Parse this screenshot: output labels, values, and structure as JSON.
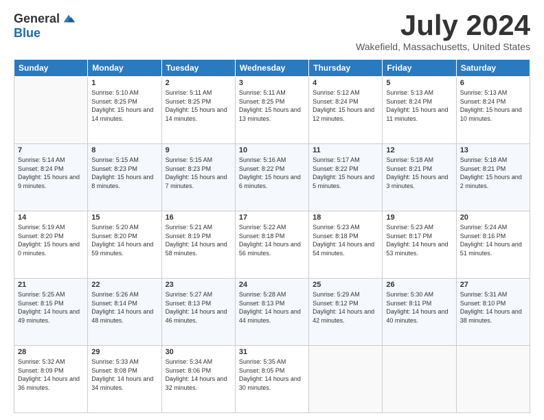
{
  "header": {
    "logo": {
      "general": "General",
      "blue": "Blue"
    },
    "title": "July 2024",
    "location": "Wakefield, Massachusetts, United States"
  },
  "days_of_week": [
    "Sunday",
    "Monday",
    "Tuesday",
    "Wednesday",
    "Thursday",
    "Friday",
    "Saturday"
  ],
  "weeks": [
    [
      {
        "day": "",
        "sunrise": "",
        "sunset": "",
        "daylight": ""
      },
      {
        "day": "1",
        "sunrise": "Sunrise: 5:10 AM",
        "sunset": "Sunset: 8:25 PM",
        "daylight": "Daylight: 15 hours and 14 minutes."
      },
      {
        "day": "2",
        "sunrise": "Sunrise: 5:11 AM",
        "sunset": "Sunset: 8:25 PM",
        "daylight": "Daylight: 15 hours and 14 minutes."
      },
      {
        "day": "3",
        "sunrise": "Sunrise: 5:11 AM",
        "sunset": "Sunset: 8:25 PM",
        "daylight": "Daylight: 15 hours and 13 minutes."
      },
      {
        "day": "4",
        "sunrise": "Sunrise: 5:12 AM",
        "sunset": "Sunset: 8:24 PM",
        "daylight": "Daylight: 15 hours and 12 minutes."
      },
      {
        "day": "5",
        "sunrise": "Sunrise: 5:13 AM",
        "sunset": "Sunset: 8:24 PM",
        "daylight": "Daylight: 15 hours and 11 minutes."
      },
      {
        "day": "6",
        "sunrise": "Sunrise: 5:13 AM",
        "sunset": "Sunset: 8:24 PM",
        "daylight": "Daylight: 15 hours and 10 minutes."
      }
    ],
    [
      {
        "day": "7",
        "sunrise": "Sunrise: 5:14 AM",
        "sunset": "Sunset: 8:24 PM",
        "daylight": "Daylight: 15 hours and 9 minutes."
      },
      {
        "day": "8",
        "sunrise": "Sunrise: 5:15 AM",
        "sunset": "Sunset: 8:23 PM",
        "daylight": "Daylight: 15 hours and 8 minutes."
      },
      {
        "day": "9",
        "sunrise": "Sunrise: 5:15 AM",
        "sunset": "Sunset: 8:23 PM",
        "daylight": "Daylight: 15 hours and 7 minutes."
      },
      {
        "day": "10",
        "sunrise": "Sunrise: 5:16 AM",
        "sunset": "Sunset: 8:22 PM",
        "daylight": "Daylight: 15 hours and 6 minutes."
      },
      {
        "day": "11",
        "sunrise": "Sunrise: 5:17 AM",
        "sunset": "Sunset: 8:22 PM",
        "daylight": "Daylight: 15 hours and 5 minutes."
      },
      {
        "day": "12",
        "sunrise": "Sunrise: 5:18 AM",
        "sunset": "Sunset: 8:21 PM",
        "daylight": "Daylight: 15 hours and 3 minutes."
      },
      {
        "day": "13",
        "sunrise": "Sunrise: 5:18 AM",
        "sunset": "Sunset: 8:21 PM",
        "daylight": "Daylight: 15 hours and 2 minutes."
      }
    ],
    [
      {
        "day": "14",
        "sunrise": "Sunrise: 5:19 AM",
        "sunset": "Sunset: 8:20 PM",
        "daylight": "Daylight: 15 hours and 0 minutes."
      },
      {
        "day": "15",
        "sunrise": "Sunrise: 5:20 AM",
        "sunset": "Sunset: 8:20 PM",
        "daylight": "Daylight: 14 hours and 59 minutes."
      },
      {
        "day": "16",
        "sunrise": "Sunrise: 5:21 AM",
        "sunset": "Sunset: 8:19 PM",
        "daylight": "Daylight: 14 hours and 58 minutes."
      },
      {
        "day": "17",
        "sunrise": "Sunrise: 5:22 AM",
        "sunset": "Sunset: 8:18 PM",
        "daylight": "Daylight: 14 hours and 56 minutes."
      },
      {
        "day": "18",
        "sunrise": "Sunrise: 5:23 AM",
        "sunset": "Sunset: 8:18 PM",
        "daylight": "Daylight: 14 hours and 54 minutes."
      },
      {
        "day": "19",
        "sunrise": "Sunrise: 5:23 AM",
        "sunset": "Sunset: 8:17 PM",
        "daylight": "Daylight: 14 hours and 53 minutes."
      },
      {
        "day": "20",
        "sunrise": "Sunrise: 5:24 AM",
        "sunset": "Sunset: 8:16 PM",
        "daylight": "Daylight: 14 hours and 51 minutes."
      }
    ],
    [
      {
        "day": "21",
        "sunrise": "Sunrise: 5:25 AM",
        "sunset": "Sunset: 8:15 PM",
        "daylight": "Daylight: 14 hours and 49 minutes."
      },
      {
        "day": "22",
        "sunrise": "Sunrise: 5:26 AM",
        "sunset": "Sunset: 8:14 PM",
        "daylight": "Daylight: 14 hours and 48 minutes."
      },
      {
        "day": "23",
        "sunrise": "Sunrise: 5:27 AM",
        "sunset": "Sunset: 8:13 PM",
        "daylight": "Daylight: 14 hours and 46 minutes."
      },
      {
        "day": "24",
        "sunrise": "Sunrise: 5:28 AM",
        "sunset": "Sunset: 8:13 PM",
        "daylight": "Daylight: 14 hours and 44 minutes."
      },
      {
        "day": "25",
        "sunrise": "Sunrise: 5:29 AM",
        "sunset": "Sunset: 8:12 PM",
        "daylight": "Daylight: 14 hours and 42 minutes."
      },
      {
        "day": "26",
        "sunrise": "Sunrise: 5:30 AM",
        "sunset": "Sunset: 8:11 PM",
        "daylight": "Daylight: 14 hours and 40 minutes."
      },
      {
        "day": "27",
        "sunrise": "Sunrise: 5:31 AM",
        "sunset": "Sunset: 8:10 PM",
        "daylight": "Daylight: 14 hours and 38 minutes."
      }
    ],
    [
      {
        "day": "28",
        "sunrise": "Sunrise: 5:32 AM",
        "sunset": "Sunset: 8:09 PM",
        "daylight": "Daylight: 14 hours and 36 minutes."
      },
      {
        "day": "29",
        "sunrise": "Sunrise: 5:33 AM",
        "sunset": "Sunset: 8:08 PM",
        "daylight": "Daylight: 14 hours and 34 minutes."
      },
      {
        "day": "30",
        "sunrise": "Sunrise: 5:34 AM",
        "sunset": "Sunset: 8:06 PM",
        "daylight": "Daylight: 14 hours and 32 minutes."
      },
      {
        "day": "31",
        "sunrise": "Sunrise: 5:35 AM",
        "sunset": "Sunset: 8:05 PM",
        "daylight": "Daylight: 14 hours and 30 minutes."
      },
      {
        "day": "",
        "sunrise": "",
        "sunset": "",
        "daylight": ""
      },
      {
        "day": "",
        "sunrise": "",
        "sunset": "",
        "daylight": ""
      },
      {
        "day": "",
        "sunrise": "",
        "sunset": "",
        "daylight": ""
      }
    ]
  ]
}
